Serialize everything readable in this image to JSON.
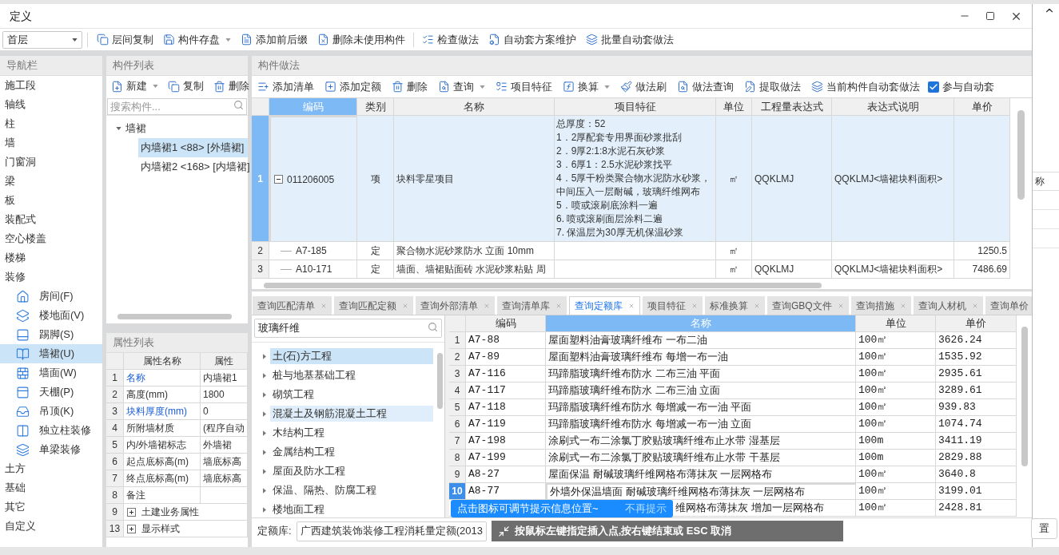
{
  "window": {
    "title": "定义"
  },
  "toolbar": {
    "floor": "首层",
    "buttons": [
      {
        "label": "层间复制",
        "menu": false
      },
      {
        "label": "构件存盘",
        "menu": true
      },
      {
        "label": "添加前后缀",
        "menu": false
      },
      {
        "label": "删除未使用构件",
        "menu": false
      },
      {
        "label": "检查做法",
        "menu": false
      },
      {
        "label": "自动套方案维护",
        "menu": false
      },
      {
        "label": "批量自动套做法",
        "menu": false
      }
    ]
  },
  "nav": {
    "title": "导航栏",
    "items": [
      {
        "label": "施工段",
        "selected": false
      },
      {
        "label": "轴线",
        "selected": false
      },
      {
        "label": "柱",
        "selected": false
      },
      {
        "label": "墙",
        "selected": false
      },
      {
        "label": "门窗洞",
        "selected": false
      },
      {
        "label": "梁",
        "selected": false
      },
      {
        "label": "板",
        "selected": false
      },
      {
        "label": "装配式",
        "selected": false
      },
      {
        "label": "空心楼盖",
        "selected": false
      },
      {
        "label": "楼梯",
        "selected": false
      },
      {
        "label": "装修",
        "selected": false,
        "children": [
          {
            "label": "房间(F)",
            "selected": false
          },
          {
            "label": "楼地面(V)",
            "selected": false
          },
          {
            "label": "踢脚(S)",
            "selected": false
          },
          {
            "label": "墙裙(U)",
            "selected": true
          },
          {
            "label": "墙面(W)",
            "selected": false
          },
          {
            "label": "天棚(P)",
            "selected": false
          },
          {
            "label": "吊顶(K)",
            "selected": false
          },
          {
            "label": "独立柱装修",
            "selected": false
          },
          {
            "label": "单梁装修",
            "selected": false
          }
        ]
      },
      {
        "label": "土方",
        "selected": false
      },
      {
        "label": "基础",
        "selected": false
      },
      {
        "label": "其它",
        "selected": false
      },
      {
        "label": "自定义",
        "selected": false
      }
    ]
  },
  "component_list": {
    "title": "构件列表",
    "buttons": [
      {
        "label": "新建",
        "menu": true
      },
      {
        "label": "复制",
        "menu": false
      },
      {
        "label": "删除",
        "menu": false
      }
    ],
    "search": {
      "placeholder": "搜索构件..."
    },
    "tree": [
      {
        "label": "墙裙",
        "expanded": true,
        "selected": false,
        "children": [
          {
            "label": "内墙裙1 <88> [外墙裙]",
            "selected": true
          },
          {
            "label": "内墙裙2 <168> [内墙裙]",
            "selected": false
          }
        ]
      }
    ]
  },
  "properties": {
    "title": "属性列表",
    "columns": [
      "属性名称",
      "属性"
    ],
    "rows": [
      {
        "index": "1",
        "kind": "field",
        "name": "名称",
        "value": "内墙裙1",
        "public": true
      },
      {
        "index": "2",
        "kind": "field",
        "name": "高度(mm)",
        "value": "1800",
        "public": false
      },
      {
        "index": "3",
        "kind": "field",
        "name": "块料厚度(mm)",
        "value": "0",
        "public": true
      },
      {
        "index": "4",
        "kind": "field",
        "name": "所附墙材质",
        "value": "(程序自动",
        "public": false
      },
      {
        "index": "5",
        "kind": "field",
        "name": "内/外墙裙标志",
        "value": "外墙裙",
        "public": false
      },
      {
        "index": "6",
        "kind": "field",
        "name": "起点底标高(m)",
        "value": "墙底标高",
        "public": false
      },
      {
        "index": "7",
        "kind": "field",
        "name": "终点底标高(m)",
        "value": "墙底标高",
        "public": false
      },
      {
        "index": "8",
        "kind": "field",
        "name": "备注",
        "public": false
      },
      {
        "index": "9",
        "kind": "group",
        "name": "土建业务属性",
        "expanded": false,
        "public": false
      },
      {
        "index": "13",
        "kind": "group",
        "name": "显示样式",
        "expanded": false,
        "public": false
      }
    ]
  },
  "methods": {
    "title": "构件做法",
    "buttons": [
      {
        "label": "添加清单",
        "menu": false
      },
      {
        "label": "添加定额",
        "menu": false
      },
      {
        "label": "删除",
        "menu": false
      },
      {
        "label": "查询",
        "menu": true
      },
      {
        "label": "项目特征",
        "menu": false
      },
      {
        "label": "换算",
        "menu": true
      },
      {
        "label": "做法刷",
        "menu": false
      },
      {
        "label": "做法查询",
        "menu": false
      },
      {
        "label": "提取做法",
        "menu": false
      },
      {
        "label": "当前构件自动套做法",
        "menu": false
      }
    ],
    "auto_apply": {
      "label": "参与自动套",
      "checked": true
    },
    "table": {
      "columns": [
        {
          "label": "编码",
          "selected": true
        },
        {
          "label": "类别",
          "selected": false
        },
        {
          "label": "名称",
          "selected": false
        },
        {
          "label": "项目特征",
          "selected": false
        },
        {
          "label": "单位",
          "selected": false
        },
        {
          "label": "工程量表达式",
          "selected": false
        },
        {
          "label": "表达式说明",
          "selected": false
        },
        {
          "label": "单价",
          "selected": false
        }
      ],
      "rows": [
        {
          "index": "1",
          "selected": true,
          "expanded": true,
          "code": "011206005",
          "category": "项",
          "name": "块料零星项目",
          "features": [
            "总厚度：52",
            "1．2厚配套专用界面砂浆批刮",
            "2．9厚2:1:8水泥石灰砂浆",
            "3．6厚1：2.5水泥砂浆找平",
            "4．5厚干粉类聚合物水泥防水砂浆，",
            "中间压入一层耐碱，玻璃纤维网布",
            "5．喷或滚刷底涂料一遍",
            "6. 喷或滚刷面层涂料二遍",
            "7. 保温层为30厚无机保温砂浆"
          ],
          "unit": "㎡",
          "quantity_expr": "QQKLMJ",
          "expr_note": "QQKLMJ<墙裙块料面积>",
          "children": [
            {
              "index": "2",
              "selected": false,
              "code": "A7-185",
              "category": "定",
              "name": "聚合物水泥砂浆防水 立面 10mm",
              "unit": "㎡",
              "price": "1250.5"
            },
            {
              "index": "3",
              "selected": false,
              "code": "A10-171",
              "category": "定",
              "name": "墙面、墙裙贴面砖 水泥砂浆粘贴 周",
              "unit": "㎡",
              "quantity_expr": "QQKLMJ",
              "expr_note": "QQKLMJ<墙裙块料面积>",
              "price": "7486.69"
            }
          ]
        }
      ]
    }
  },
  "query": {
    "tabs": [
      {
        "label": "查询匹配清单",
        "selected": false,
        "closable": true
      },
      {
        "label": "查询匹配定额",
        "selected": false,
        "closable": true
      },
      {
        "label": "查询外部清单",
        "selected": false,
        "closable": true
      },
      {
        "label": "查询清单库",
        "selected": false,
        "closable": true
      },
      {
        "label": "查询定额库",
        "selected": true,
        "closable": true
      },
      {
        "label": "项目特征",
        "selected": false,
        "closable": true
      },
      {
        "label": "标准换算",
        "selected": false,
        "closable": true
      },
      {
        "label": "查询GBQ文件",
        "selected": false,
        "closable": true
      },
      {
        "label": "查询措施",
        "selected": false,
        "closable": true
      },
      {
        "label": "查询人材机",
        "selected": false,
        "closable": true
      },
      {
        "label": "查询单价",
        "selected": false,
        "closable": false
      }
    ],
    "search": {
      "value": "玻璃纤维"
    },
    "tree": [
      {
        "label": "土(石)方工程",
        "expanded": false,
        "selected": true,
        "hovered": false
      },
      {
        "label": "桩与地基基础工程",
        "expanded": false,
        "selected": false,
        "hovered": false
      },
      {
        "label": "砌筑工程",
        "expanded": false,
        "selected": false,
        "hovered": false
      },
      {
        "label": "混凝土及钢筋混凝土工程",
        "expanded": false,
        "selected": false,
        "hovered": true
      },
      {
        "label": "木结构工程",
        "expanded": false,
        "selected": false,
        "hovered": false
      },
      {
        "label": "金属结构工程",
        "expanded": false,
        "selected": false,
        "hovered": false
      },
      {
        "label": "屋面及防水工程",
        "expanded": false,
        "selected": false,
        "hovered": false
      },
      {
        "label": "保温、隔热、防腐工程",
        "expanded": false,
        "selected": false,
        "hovered": false
      },
      {
        "label": "楼地面工程",
        "expanded": false,
        "selected": false,
        "hovered": false
      }
    ],
    "quota_table": {
      "columns": [
        {
          "label": "编码",
          "selected": false
        },
        {
          "label": "名称",
          "selected": true
        },
        {
          "label": "单位",
          "selected": false
        },
        {
          "label": "单价",
          "selected": false
        }
      ],
      "rows": [
        {
          "index": "1",
          "selected": false,
          "code": "A7-88",
          "name": "屋面塑料油膏玻璃纤维布 一布二油",
          "unit": "100㎡",
          "price": "3626.24"
        },
        {
          "index": "2",
          "selected": false,
          "code": "A7-89",
          "name": "屋面塑料油膏玻璃纤维布 每增一布一油",
          "unit": "100㎡",
          "price": "1535.92"
        },
        {
          "index": "3",
          "selected": false,
          "code": "A7-116",
          "name": "玛蹄脂玻璃纤维布防水 二布三油 平面",
          "unit": "100㎡",
          "price": "2935.61"
        },
        {
          "index": "4",
          "selected": false,
          "code": "A7-117",
          "name": "玛蹄脂玻璃纤维布防水 二布三油 立面",
          "unit": "100㎡",
          "price": "3289.61"
        },
        {
          "index": "5",
          "selected": false,
          "code": "A7-118",
          "name": "玛蹄脂玻璃纤维布防水 每增减一布一油 平面",
          "unit": "100㎡",
          "price": "939.83"
        },
        {
          "index": "6",
          "selected": false,
          "code": "A7-119",
          "name": "玛蹄脂玻璃纤维布防水 每增减一布一油 立面",
          "unit": "100㎡",
          "price": "1074.74"
        },
        {
          "index": "7",
          "selected": false,
          "code": "A7-198",
          "name": "涂刷式一布二涂氯丁胶贴玻璃纤维布止水带 湿基层",
          "unit": "100m",
          "price": "3411.19"
        },
        {
          "index": "8",
          "selected": false,
          "code": "A7-199",
          "name": "涂刷式一布二涂氯丁胶贴玻璃纤维布止水带 干基层",
          "unit": "100m",
          "price": "2829.88"
        },
        {
          "index": "9",
          "selected": false,
          "code": "A8-27",
          "name": "屋面保温 耐碱玻璃纤维网格布薄抹灰 一层网格布",
          "unit": "100㎡",
          "price": "3640.8"
        },
        {
          "index": "10",
          "selected": true,
          "code": "A8-77",
          "name": "外墙外保温墙面 耐碱玻璃纤维网格布薄抹灰 一层网格布",
          "unit": "100㎡",
          "price": "3199.01"
        },
        {
          "selected": false,
          "name": "维网格布薄抹灰 增加一层网格布",
          "unit": "100㎡",
          "price": "2428.81"
        }
      ]
    },
    "library": {
      "label": "定额库:",
      "value": "广西建筑装饰装修工程消耗量定额(2013"
    }
  },
  "tooltip": {
    "message": "点击图标可调节提示信息位置~",
    "dismiss": "不再提示"
  },
  "status_hint": {
    "message": "按鼠标左键指定插入点,按右键结束或 ESC 取消"
  },
  "background_window": {
    "heading_fragment": "称",
    "button_fragment": "置"
  }
}
